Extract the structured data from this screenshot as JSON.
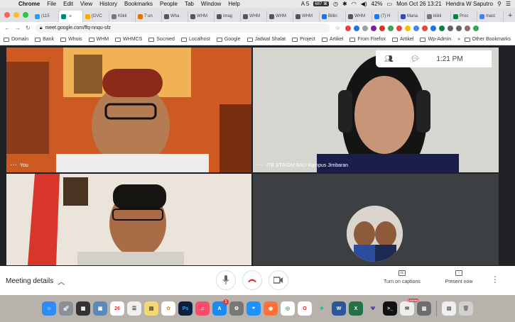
{
  "menubar": {
    "app": "Chrome",
    "items": [
      "File",
      "Edit",
      "View",
      "History",
      "Bookmarks",
      "People",
      "Tab",
      "Window",
      "Help"
    ],
    "status": {
      "ai": "A 5",
      "badge": "687 ⌘",
      "battery": "42%",
      "datetime": "Mon Oct 26 13:21",
      "user": "Hendra W Saputro"
    }
  },
  "tabs": [
    {
      "label": "(115",
      "color": "#2b9bf4"
    },
    {
      "label": "",
      "color": "#00897b",
      "active": true,
      "close": "×"
    },
    {
      "label": "[GVC",
      "color": "#f9ab00"
    },
    {
      "label": "Klikli",
      "color": "#777777"
    },
    {
      "label": "7 un",
      "color": "#e37400"
    },
    {
      "label": "Wha",
      "color": "#555555"
    },
    {
      "label": "WHM",
      "color": "#555555"
    },
    {
      "label": "imag",
      "color": "#555555"
    },
    {
      "label": "WHM",
      "color": "#555555"
    },
    {
      "label": "WHM",
      "color": "#555555"
    },
    {
      "label": "WHM",
      "color": "#555555"
    },
    {
      "label": "Billin",
      "color": "#1a73e8"
    },
    {
      "label": "WHM",
      "color": "#555555"
    },
    {
      "label": "(7) H",
      "color": "#1877f2"
    },
    {
      "label": "Mana",
      "color": "#3949ab"
    },
    {
      "label": "klikli",
      "color": "#777777"
    },
    {
      "label": "Proc",
      "color": "#0b8043"
    },
    {
      "label": "mast",
      "color": "#4285f4"
    }
  ],
  "newtab": "+",
  "address": {
    "url": "meet.google.com/ffq-nnqu-sfz"
  },
  "bookmarks": [
    {
      "label": "Domain"
    },
    {
      "label": "Bank"
    },
    {
      "label": "Whois"
    },
    {
      "label": "WHM"
    },
    {
      "label": "WHMCS"
    },
    {
      "label": "Socmed"
    },
    {
      "label": "Localhost"
    },
    {
      "label": "Google"
    },
    {
      "label": "Jadwal Shalat"
    },
    {
      "label": "Project"
    },
    {
      "label": "Artikel"
    },
    {
      "label": "From Firefox"
    },
    {
      "label": "Artikel"
    },
    {
      "label": "Wp-Admin"
    },
    {
      "label": "»"
    }
  ],
  "bookmark_other": "Other Bookmarks",
  "meet": {
    "time": "1:21 PM",
    "tiles": [
      {
        "name": "You"
      },
      {
        "name": "ITB STIKOM BALI Kampus Jimbaran"
      },
      {
        "name": ""
      },
      {
        "name": ""
      }
    ],
    "meeting_details": "Meeting details",
    "captions_label": "Turn on captions",
    "present_label": "Present now",
    "captions_icon": "cc",
    "more_icon": "⋮"
  },
  "dock": {
    "calendar_day": "26",
    "badge_appstore": "1",
    "badge_mail": "144194"
  }
}
